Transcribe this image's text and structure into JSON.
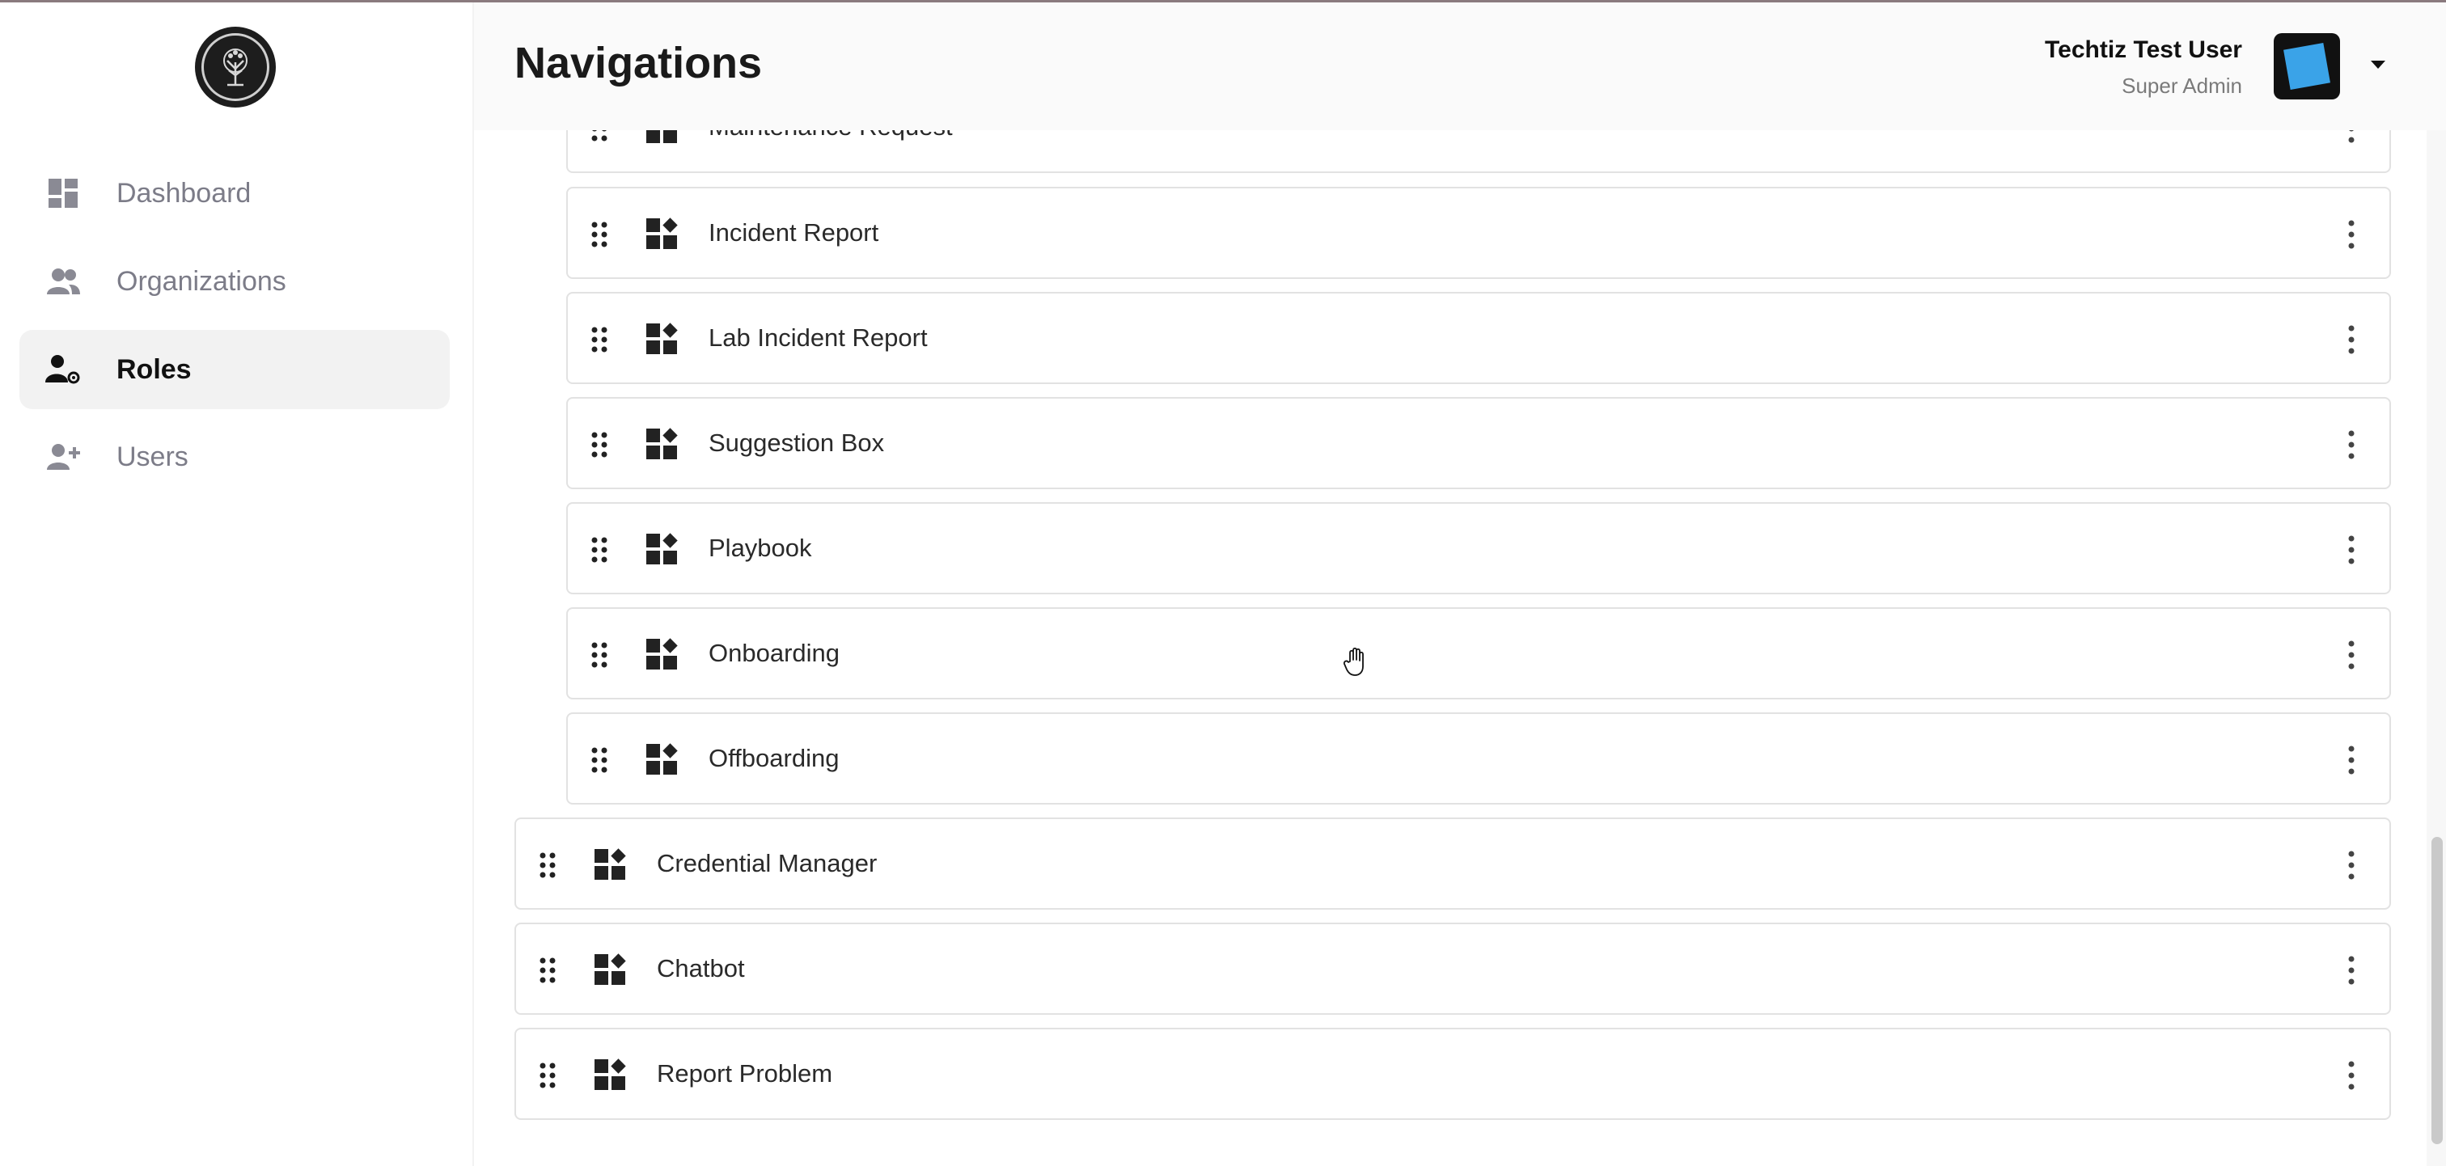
{
  "header": {
    "title": "Navigations",
    "user_name": "Techtiz Test User",
    "user_role": "Super Admin"
  },
  "sidebar": {
    "items": [
      {
        "label": "Dashboard",
        "icon": "dashboard-icon"
      },
      {
        "label": "Organizations",
        "icon": "people-icon"
      },
      {
        "label": "Roles",
        "icon": "user-gear-icon",
        "active": true
      },
      {
        "label": "Users",
        "icon": "user-add-icon"
      }
    ]
  },
  "navigation": {
    "partial_item": {
      "label": "Maintenance Request"
    },
    "child_items": [
      {
        "label": "Incident Report"
      },
      {
        "label": "Lab Incident Report"
      },
      {
        "label": "Suggestion Box"
      },
      {
        "label": "Playbook"
      },
      {
        "label": "Onboarding"
      },
      {
        "label": "Offboarding"
      }
    ],
    "top_items": [
      {
        "label": "Credential Manager"
      },
      {
        "label": "Chatbot"
      },
      {
        "label": "Report Problem"
      }
    ]
  },
  "icons": {
    "drag": "drag-handle-icon",
    "module": "widgets-icon",
    "menu": "more-vertical-icon"
  }
}
